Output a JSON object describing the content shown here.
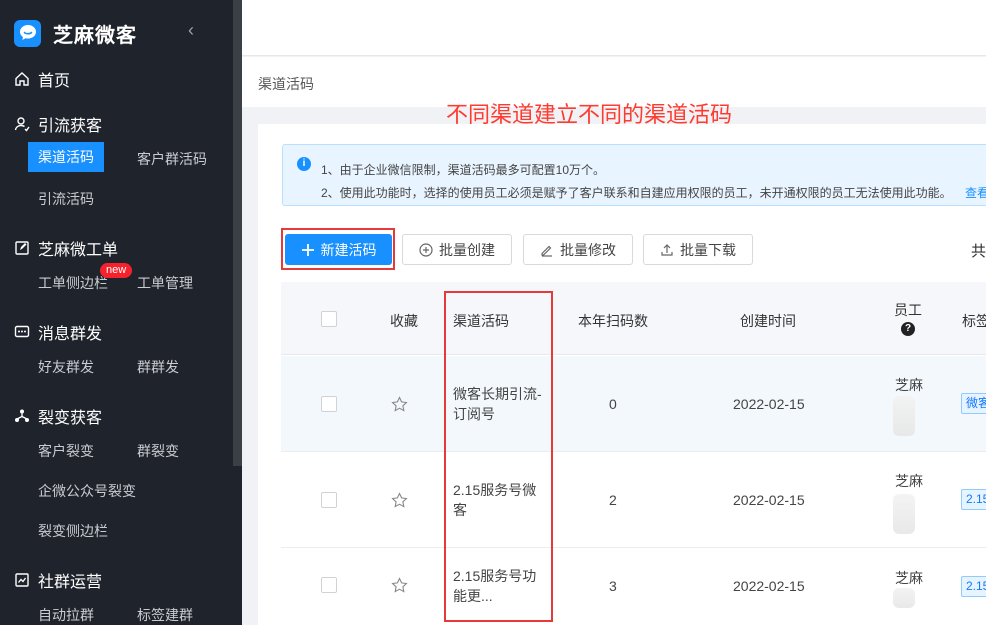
{
  "brand": {
    "name": "芝麻微客",
    "collapse_icon": "chevron-left-icon"
  },
  "sidebar": {
    "home": "首页",
    "groups": [
      {
        "label": "引流获客",
        "items": [
          "渠道活码",
          "客户群活码",
          "引流活码"
        ]
      },
      {
        "label": "芝麻微工单",
        "items": [
          "工单侧边栏",
          "工单管理"
        ],
        "badge": "new"
      },
      {
        "label": "消息群发",
        "items": [
          "好友群发",
          "群群发"
        ]
      },
      {
        "label": "裂变获客",
        "items": [
          "客户裂变",
          "群裂变",
          "企微公众号裂变",
          "裂变侧边栏"
        ]
      },
      {
        "label": "社群运营",
        "items": [
          "自动拉群",
          "标签建群"
        ]
      }
    ]
  },
  "breadcrumb": "渠道活码",
  "annotation": "不同渠道建立不同的渠道活码",
  "notice": {
    "line1": "1、由于企业微信限制，渠道活码最多可配置10万个。",
    "line2": "2、使用此功能时，选择的使用员工必须是赋予了客户联系和自建应用权限的员工，未开通权限的员工无法使用此功能。",
    "link": "查看"
  },
  "toolbar": {
    "new": "新建活码",
    "batch_create": "批量创建",
    "batch_edit": "批量修改",
    "batch_download": "批量下载",
    "total_prefix": "共"
  },
  "table": {
    "headers": {
      "fav": "收藏",
      "name": "渠道活码",
      "scans": "本年扫码数",
      "created": "创建时间",
      "employee": "员工",
      "tags": "标签"
    },
    "rows": [
      {
        "name": "微客长期引流-订阅号",
        "scans": "0",
        "created": "2022-02-15",
        "employee": "芝麻",
        "tag": "微客"
      },
      {
        "name": "2.15服务号微客",
        "scans": "2",
        "created": "2022-02-15",
        "employee": "芝麻",
        "tag": "2.15"
      },
      {
        "name": "2.15服务号功能更...",
        "scans": "3",
        "created": "2022-02-15",
        "employee": "芝麻",
        "tag": "2.15"
      }
    ]
  },
  "colors": {
    "sidebar_bg": "#1f232b",
    "accent": "#1890ff",
    "annotation": "#ff3b30",
    "highlight_box": "#e43a3a"
  }
}
